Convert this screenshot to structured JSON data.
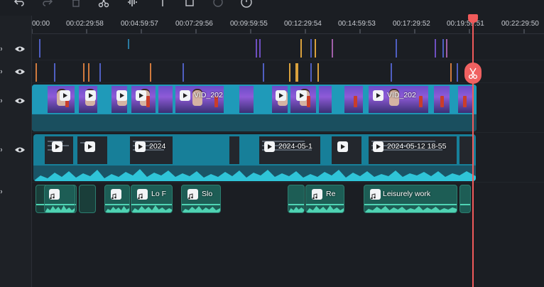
{
  "toolbar": {
    "icons": [
      "undo-icon",
      "redo-icon",
      "delete-icon",
      "scissors-icon",
      "audio-split-icon",
      "text-icon",
      "crop-icon",
      "color-icon",
      "speed-icon"
    ]
  },
  "ruler": {
    "labels": [
      "00:00",
      "00:02:29:58",
      "00:04:59:57",
      "00:07:29:56",
      "00:09:59:55",
      "00:12:29:54",
      "00:14:59:53",
      "00:17:29:52",
      "00:19:59:51",
      "00:22:29:50"
    ]
  },
  "tracks": {
    "video_main_label": "VID_202",
    "video_main_label_2": "VID_202",
    "screen_clip_1": "2024",
    "screen_clip_2": "2024-05-1",
    "screen_clip_3": "2024-05-12 18-55",
    "audio_clip_1": "Lo F",
    "audio_clip_2": "Slo",
    "audio_clip_3": "Re",
    "audio_clip_4": "Leisurely work"
  },
  "colors": {
    "playhead": "#f05a5a",
    "video_clip": "#1f9ab9",
    "audio_clip": "#1d5d55",
    "audio_wave": "#4fd3b3"
  }
}
